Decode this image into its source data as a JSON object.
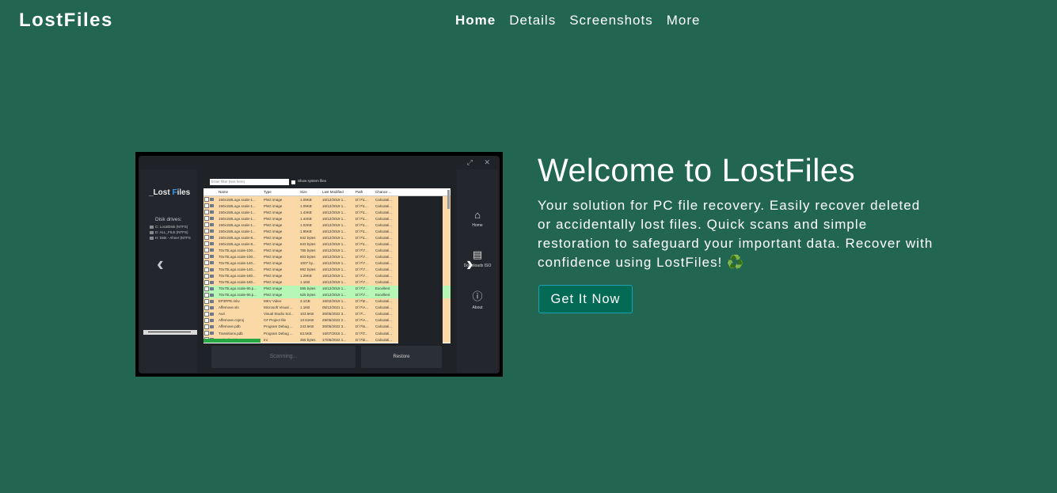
{
  "brand": "LostFiles",
  "nav": {
    "items": [
      "Home",
      "Details",
      "Screenshots",
      "More"
    ],
    "active": "Home"
  },
  "hero": {
    "title": "Welcome to LostFiles",
    "lead": "Your solution for PC file recovery. Easily recover deleted or accidentally lost files. Quick scans and simple restoration to safeguard your important data. Recover with confidence using LostFiles!",
    "lead_emoji": "♻️",
    "cta": "Get It Now"
  },
  "carousel": {
    "prev": "‹",
    "next": "›"
  },
  "screenshot": {
    "logo_a": "_Lost ",
    "logo_b": "F",
    "logo_c": "iles",
    "window_controls": "⤢ ✕",
    "disk_label": "Disk drives:",
    "drives": [
      "C: LocalDisk (NTFS)",
      "D: ALL_FILE (NTFS)",
      "H: Disk - Ahner (NTFS"
    ],
    "filter_placeholder": "Enter filter (text here)",
    "system_files_label": "Show system files",
    "columns": [
      "Name",
      "Type",
      "Size",
      "Last Modified",
      "Path",
      "Chance ..."
    ],
    "rows": [
      {
        "name": "150x150Logo.scale-1...",
        "type": "PNG image",
        "size": "1.09KB",
        "date": "16/12/2019 1...",
        "path": "D:\\?\\1...",
        "chance": "Calculati...",
        "tone": "o"
      },
      {
        "name": "150x150Logo.scale-1...",
        "type": "PNG image",
        "size": "1.09KB",
        "date": "16/12/2019 1...",
        "path": "D:\\?\\1...",
        "chance": "Calculati...",
        "tone": "o"
      },
      {
        "name": "150x150Logo.scale-1...",
        "type": "PNG image",
        "size": "1.43KB",
        "date": "16/12/2019 1...",
        "path": "D:\\?\\1...",
        "chance": "Calculati...",
        "tone": "o"
      },
      {
        "name": "150x150Logo.scale-1...",
        "type": "PNG image",
        "size": "1.44KB",
        "date": "16/12/2019 1...",
        "path": "D:\\?\\1...",
        "chance": "Calculati...",
        "tone": "o"
      },
      {
        "name": "150x150Logo.scale-1...",
        "type": "PNG image",
        "size": "1.02KB",
        "date": "16/12/2019 1...",
        "path": "D:\\?\\1...",
        "chance": "Calculati...",
        "tone": "o"
      },
      {
        "name": "150x150Logo.scale-1...",
        "type": "PNG image",
        "size": "1.95KB",
        "date": "16/12/2019 1...",
        "path": "D:\\?\\1...",
        "chance": "Calculati...",
        "tone": "o"
      },
      {
        "name": "150x150Logo.scale-8...",
        "type": "PNG image",
        "size": "842 bytes",
        "date": "16/12/2019 1...",
        "path": "D:\\?\\1...",
        "chance": "Calculati...",
        "tone": "o"
      },
      {
        "name": "150x150Logo.scale-8...",
        "type": "PNG image",
        "size": "843 bytes",
        "date": "16/12/2019 1...",
        "path": "D:\\?\\1...",
        "chance": "Calculati...",
        "tone": "o"
      },
      {
        "name": "70x70Logo.scale-100...",
        "type": "PNG image",
        "size": "786 bytes",
        "date": "15/12/2019 1...",
        "path": "D:\\?\\7...",
        "chance": "Calculati...",
        "tone": "o"
      },
      {
        "name": "70x70Logo.scale-100...",
        "type": "PNG image",
        "size": "803 bytes",
        "date": "16/12/2019 1...",
        "path": "D:\\?\\7...",
        "chance": "Calculati...",
        "tone": "o"
      },
      {
        "name": "70x70Logo.scale-140...",
        "type": "PNG image",
        "size": "1007 by...",
        "date": "16/12/2019 1...",
        "path": "D:\\?\\7...",
        "chance": "Calculati...",
        "tone": "o"
      },
      {
        "name": "70x70Logo.scale-140...",
        "type": "PNG image",
        "size": "892 bytes",
        "date": "16/12/2019 1...",
        "path": "D:\\?\\7...",
        "chance": "Calculati...",
        "tone": "o"
      },
      {
        "name": "70x70Logo.scale-180...",
        "type": "PNG image",
        "size": "1.29KB",
        "date": "16/12/2019 1...",
        "path": "D:\\?\\7...",
        "chance": "Calculati...",
        "tone": "o"
      },
      {
        "name": "70x70Logo.scale-180...",
        "type": "PNG image",
        "size": "1.1KB",
        "date": "16/12/2019 1...",
        "path": "D:\\?\\7...",
        "chance": "Calculati...",
        "tone": "o"
      },
      {
        "name": "70x70Logo.scale-80.p...",
        "type": "PNG image",
        "size": "595 bytes",
        "date": "16/12/2019 1...",
        "path": "D:\\?\\7...",
        "chance": "Excellent",
        "tone": "g"
      },
      {
        "name": "70x70Logo.scale-80.p...",
        "type": "PNG image",
        "size": "625 bytes",
        "date": "16/12/2019 1...",
        "path": "D:\\?\\7...",
        "chance": "Excellent",
        "tone": "g"
      },
      {
        "name": "EP3FPE.mkv",
        "type": "MKV Video",
        "size": "3.1GB",
        "date": "16/02/2019 1...",
        "path": "D:\\?\\E...",
        "chance": "Calculati...",
        "tone": "o"
      },
      {
        "name": "Affemove.sln",
        "type": "Microsoft Visual ...",
        "size": "1.1KB",
        "date": "05/12/2021 1...",
        "path": "D:\\?\\A...",
        "chance": "Calculati...",
        "tone": "o"
      },
      {
        "name": "Auri",
        "type": "Visual Studio Sol...",
        "size": "103.5KB",
        "date": "30/05/2022 3...",
        "path": "D:\\?\\...",
        "chance": "Calculati...",
        "tone": "o"
      },
      {
        "name": "Affemove.csproj",
        "type": "C# Project file",
        "size": "13.51KB",
        "date": "29/05/2022 2...",
        "path": "D:\\?\\A...",
        "chance": "Calculati...",
        "tone": "o"
      },
      {
        "name": "Affemove.pdb",
        "type": "Program Debug ...",
        "size": "243.5KB",
        "date": "30/05/2022 3...",
        "path": "D:\\?\\6...",
        "chance": "Calculati...",
        "tone": "o"
      },
      {
        "name": "Transitions.pdb",
        "type": "Program Debug ...",
        "size": "63.5KB",
        "date": "16/07/2015 1...",
        "path": "D:\\?\\T...",
        "chance": "Calculati...",
        "tone": "o"
      },
      {
        "name": "EPlaylist.ini",
        "type": "Ini",
        "size": "355 bytes",
        "date": "17/05/2022 1...",
        "path": "D:\\?\\E...",
        "chance": "Calculati...",
        "tone": "o"
      }
    ],
    "scan_button": "Scanning...",
    "restore_button": "Restore",
    "side_nav": [
      {
        "icon": "⌂",
        "label": "Home"
      },
      {
        "icon": "▤",
        "label": "Downloads ISO"
      },
      {
        "icon": "ⓘ",
        "label": "About"
      }
    ],
    "scan_progress": 0.23
  }
}
